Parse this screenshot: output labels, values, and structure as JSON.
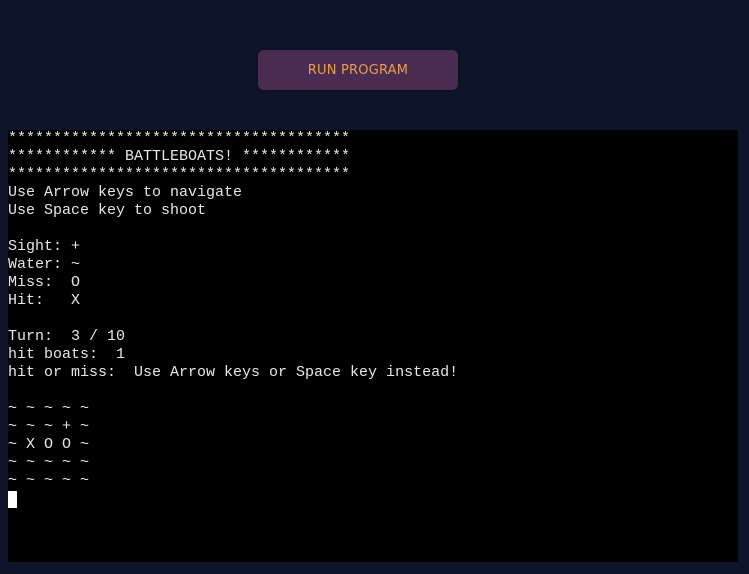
{
  "run_button_label": "RUN PROGRAM",
  "terminal_lines": [
    "**************************************",
    "************ BATTLEBOATS! ************",
    "**************************************",
    "Use Arrow keys to navigate",
    "Use Space key to shoot",
    "",
    "Sight: +",
    "Water: ~",
    "Miss:  O",
    "Hit:   X",
    "",
    "Turn:  3 / 10",
    "hit boats:  1",
    "hit or miss:  Use Arrow keys or Space key instead!",
    "",
    "~ ~ ~ ~ ~",
    "~ ~ ~ + ~",
    "~ X O O ~",
    "~ ~ ~ ~ ~",
    "~ ~ ~ ~ ~"
  ],
  "colors": {
    "page_background": "#0e1429",
    "button_background": "#4a2c52",
    "button_text": "#e8a04a",
    "terminal_background": "#000000",
    "terminal_text": "#e6e6e6"
  }
}
